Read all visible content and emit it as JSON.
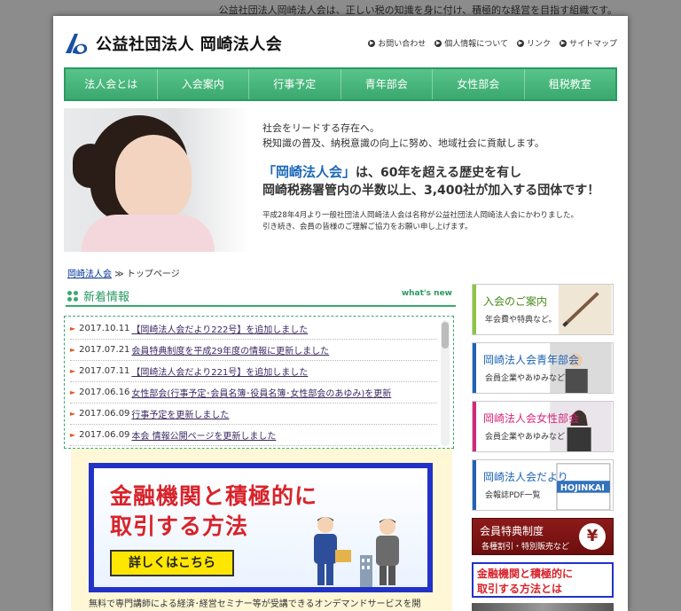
{
  "tagline": "公益社団法人岡崎法人会は、正しい税の知識を身に付け、積極的な経営を目指す組織です。",
  "header": {
    "org_name": "公益社団法人 岡崎法人会",
    "links": [
      "お問い合わせ",
      "個人情報について",
      "リンク",
      "サイトマップ"
    ]
  },
  "nav": [
    "法人会とは",
    "入会案内",
    "行事予定",
    "青年部会",
    "女性部会",
    "租税教室"
  ],
  "hero": {
    "lead1": "社会をリードする存在へ。",
    "lead2": "税知識の普及、納税意識の向上に努め、地域社会に貢献します。",
    "big1_highlight": "「岡崎法人会」",
    "big1_rest": "は、60年を超える歴史を有し",
    "big2": "岡崎税務署管内の半数以上、3,400社が加入する団体です！",
    "note1": "平成28年4月より一般社団法人岡崎法人会は名称が公益社団法人岡崎法人会にかわりました。",
    "note2": "引き続き、会員の皆様のご理解ご協力をお願い申し上げます。"
  },
  "breadcrumb": {
    "home": "岡崎法人会",
    "sep": "≫",
    "current": "トップページ"
  },
  "news": {
    "title": "新着情報",
    "subtitle": "what's new",
    "items": [
      {
        "date": "2017.10.11",
        "text": "【岡崎法人会だより222号】を追加しました"
      },
      {
        "date": "2017.07.21",
        "text": "会員特典制度を平成29年度の情報に更新しました"
      },
      {
        "date": "2017.07.11",
        "text": "【岡崎法人会だより221号】を追加しました"
      },
      {
        "date": "2017.06.16",
        "text": "女性部会(行事予定･会員名簿･役員名簿･女性部会のあゆみ)を更新"
      },
      {
        "date": "2017.06.09",
        "text": "行事予定を更新しました"
      },
      {
        "date": "2017.06.09",
        "text": "本会 情報公開ページを更新しました"
      }
    ]
  },
  "banner": {
    "line1": "金融機関と積極的に",
    "line2": "取引する方法",
    "button": "詳しくはこちら",
    "desc": "無料で専門講師による経済･経営セミナー等が受講できるオンデマンドサービスを開"
  },
  "sidebar": {
    "cards": [
      {
        "title": "入会のご案内",
        "desc": "年会費や特典など。",
        "color": "#8cc63f"
      },
      {
        "title": "岡崎法人会青年部会",
        "desc": "会員企業やあゆみなど",
        "color": "#1e63b5"
      },
      {
        "title": "岡崎法人会女性部会",
        "desc": "会員企業やあゆみなど",
        "color": "#d6267a"
      },
      {
        "title": "岡崎法人会だより",
        "desc": "会報誌PDF一覧",
        "color": "#1e63b5"
      }
    ],
    "card_image_text": "HOJINKAI",
    "benefit_title": "会員特典制度",
    "benefit_desc": "各種割引・特別販売など",
    "benefit_icon": "¥",
    "mini_line1": "金融機関と積極的に",
    "mini_line2": "取引する方法とは"
  },
  "colors": {
    "nav_green": "#3aa96f",
    "banner_blue": "#2232c8",
    "banner_red": "#d8232a"
  }
}
